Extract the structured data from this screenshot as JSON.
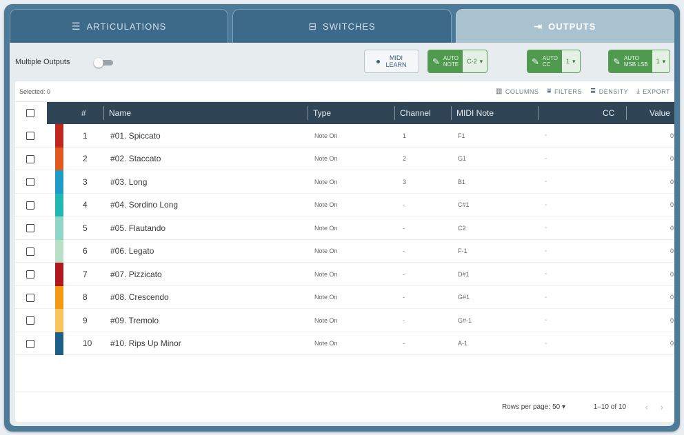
{
  "tabs": [
    {
      "label": "ARTICULATIONS",
      "icon": "list-icon"
    },
    {
      "label": "SWITCHES",
      "icon": "switch-icon"
    },
    {
      "label": "OUTPUTS",
      "icon": "output-icon"
    }
  ],
  "active_tab": "OUTPUTS",
  "toolbar": {
    "multiple_outputs_label": "Multiple Outputs",
    "midi_learn_line1": "MIDI",
    "midi_learn_line2": "LEARN",
    "auto_note_line1": "AUTO",
    "auto_note_line2": "NOTE",
    "auto_note_value": "C-2",
    "auto_cc_line1": "AUTO",
    "auto_cc_line2": "CC",
    "auto_cc_value": "1",
    "auto_msb_line1": "AUTO",
    "auto_msb_line2": "MSB LSB",
    "auto_msb_value": "1",
    "dropdown_glyph": "▾"
  },
  "grid": {
    "selected_label": "Selected: 0",
    "columns_label": "COLUMNS",
    "filters_label": "FILTERS",
    "density_label": "DENSITY",
    "export_label": "EXPORT"
  },
  "columns": [
    "#",
    "Name",
    "Type",
    "Channel",
    "MIDI Note",
    "CC",
    "Value"
  ],
  "rows": [
    {
      "num": "1",
      "name": "#01. Spiccato",
      "type": "Note On",
      "channel": "1",
      "note": "F1",
      "cc": "-",
      "value": "0",
      "color": "#c0281f"
    },
    {
      "num": "2",
      "name": "#02. Staccato",
      "type": "Note On",
      "channel": "2",
      "note": "G1",
      "cc": "-",
      "value": "0",
      "color": "#e05a1e"
    },
    {
      "num": "3",
      "name": "#03. Long",
      "type": "Note On",
      "channel": "3",
      "note": "B1",
      "cc": "-",
      "value": "0",
      "color": "#1e9bc8"
    },
    {
      "num": "4",
      "name": "#04. Sordino Long",
      "type": "Note On",
      "channel": "-",
      "note": "C#1",
      "cc": "-",
      "value": "0",
      "color": "#21b8b4"
    },
    {
      "num": "5",
      "name": "#05. Flautando",
      "type": "Note On",
      "channel": "-",
      "note": "C2",
      "cc": "-",
      "value": "0",
      "color": "#8fd6c8"
    },
    {
      "num": "6",
      "name": "#06. Legato",
      "type": "Note On",
      "channel": "-",
      "note": "F-1",
      "cc": "-",
      "value": "0",
      "color": "#b9e0c6"
    },
    {
      "num": "7",
      "name": "#07. Pizzicato",
      "type": "Note On",
      "channel": "-",
      "note": "D#1",
      "cc": "-",
      "value": "0",
      "color": "#b0181e"
    },
    {
      "num": "8",
      "name": "#08. Crescendo",
      "type": "Note On",
      "channel": "-",
      "note": "G#1",
      "cc": "-",
      "value": "0",
      "color": "#f39a12"
    },
    {
      "num": "9",
      "name": "#09. Tremolo",
      "type": "Note On",
      "channel": "-",
      "note": "G#-1",
      "cc": "-",
      "value": "0",
      "color": "#f7c35a"
    },
    {
      "num": "10",
      "name": "#10. Rips Up Minor",
      "type": "Note On",
      "channel": "-",
      "note": "A-1",
      "cc": "-",
      "value": "0",
      "color": "#1e5f8a"
    }
  ],
  "footer": {
    "rows_per_page_label": "Rows per page:",
    "rows_per_page_value": "50",
    "range_label": "1–10 of 10",
    "prev_glyph": "‹",
    "next_glyph": "›"
  }
}
